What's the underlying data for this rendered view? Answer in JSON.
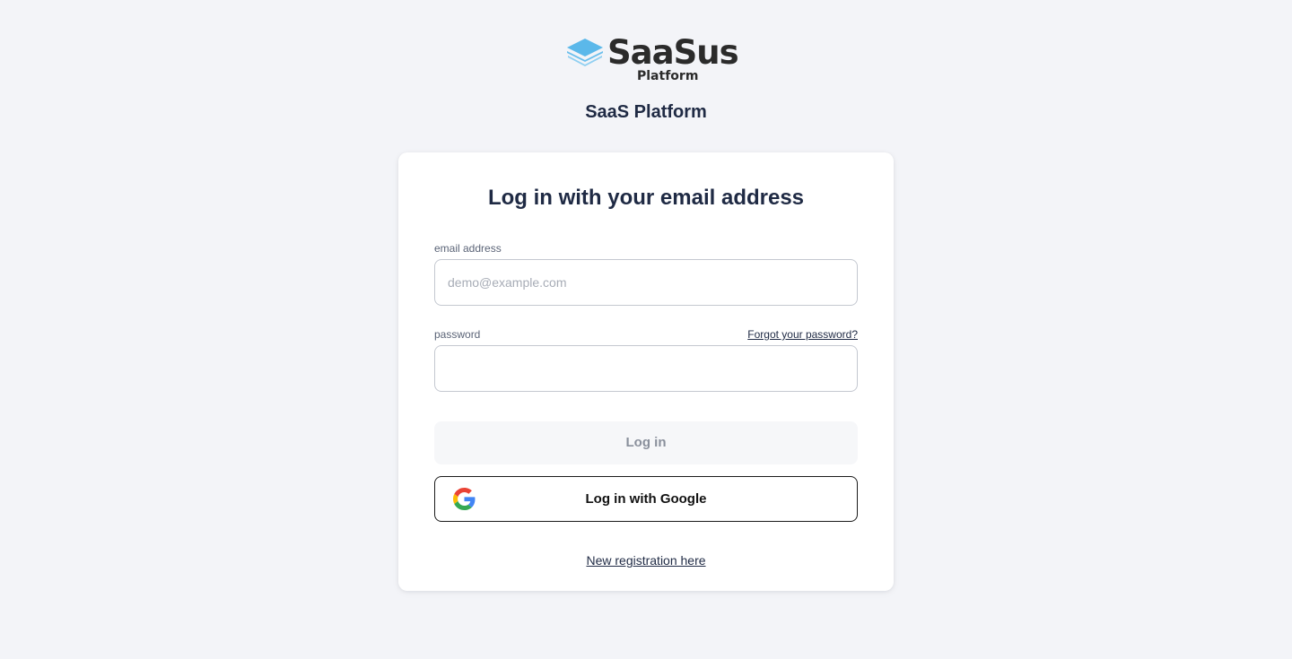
{
  "brand": {
    "logo_word": "SaaSus",
    "logo_sub": "Platform",
    "logo_icon": "stacked-layers-icon",
    "logo_color": "#5bb8ea"
  },
  "app_title": "SaaS Platform",
  "card": {
    "title": "Log in with your email address",
    "email": {
      "label": "email address",
      "placeholder": "demo@example.com",
      "value": ""
    },
    "password": {
      "label": "password",
      "value": "",
      "forgot_link": "Forgot your password?"
    },
    "login_button": "Log in",
    "google_button": {
      "label": "Log in with Google",
      "icon": "google-g-icon"
    },
    "register_link": "New registration here"
  },
  "colors": {
    "background": "#f3f4f8",
    "text": "#1f2a44",
    "disabled_button": "#f6f7f9"
  }
}
